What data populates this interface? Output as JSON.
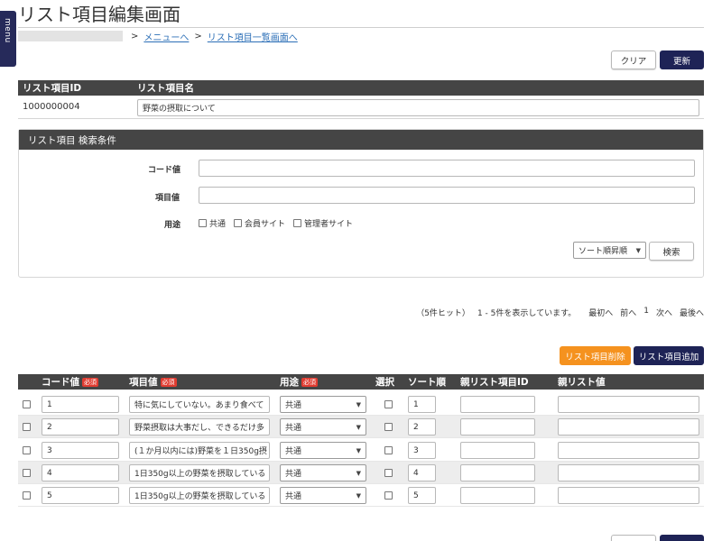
{
  "menu": {
    "label": "menu"
  },
  "page": {
    "title": "リスト項目編集画面"
  },
  "breadcrumb": {
    "sep": ">",
    "link1": "メニューへ",
    "link2": "リスト項目一覧画面へ"
  },
  "actions": {
    "clear": "クリア",
    "update": "更新"
  },
  "item_table": {
    "headers": [
      "リスト項目ID",
      "リスト項目名"
    ],
    "id": "1000000004",
    "name": "野菜の摂取について"
  },
  "search": {
    "title": "リスト項目 検索条件",
    "code_label": "コード値",
    "code_value": "",
    "item_label": "項目値",
    "item_value": "",
    "usage_label": "用途",
    "usage_options": [
      "共通",
      "会員サイト",
      "管理者サイト"
    ],
    "sort_value": "ソート順昇順",
    "search_button": "検索"
  },
  "pager": {
    "hits": "（5件ヒット）",
    "range": "1 - 5件を表示しています。",
    "first": "最初へ",
    "prev": "前へ",
    "current": "1",
    "next": "次へ",
    "last": "最後へ"
  },
  "list_actions": {
    "delete": "リスト項目削除",
    "add": "リスト項目追加"
  },
  "list": {
    "required_badge": "必須",
    "headers": {
      "code": "コード値",
      "item": "項目値",
      "usage": "用途",
      "select": "選択",
      "sort": "ソート順",
      "parent_id": "親リスト項目ID",
      "parent_value": "親リスト値"
    },
    "rows": [
      {
        "code": "1",
        "item": "特に気にしていない。あまり食べて",
        "usage": "共通",
        "sort": "1",
        "parent_id": "",
        "parent_value": ""
      },
      {
        "code": "2",
        "item": "野菜摂取は大事だし、できるだけ多",
        "usage": "共通",
        "sort": "2",
        "parent_id": "",
        "parent_value": ""
      },
      {
        "code": "3",
        "item": "(１か月以内には)野菜を１日350g摂",
        "usage": "共通",
        "sort": "3",
        "parent_id": "",
        "parent_value": ""
      },
      {
        "code": "4",
        "item": "1日350g以上の野菜を摂取している",
        "usage": "共通",
        "sort": "4",
        "parent_id": "",
        "parent_value": ""
      },
      {
        "code": "5",
        "item": "1日350g以上の野菜を摂取している",
        "usage": "共通",
        "sort": "5",
        "parent_id": "",
        "parent_value": ""
      }
    ]
  },
  "colors": {
    "navy": "#1e2356",
    "orange": "#f5921f",
    "header_bar": "#454545",
    "required": "#e03c31",
    "link": "#2c6fb7"
  }
}
